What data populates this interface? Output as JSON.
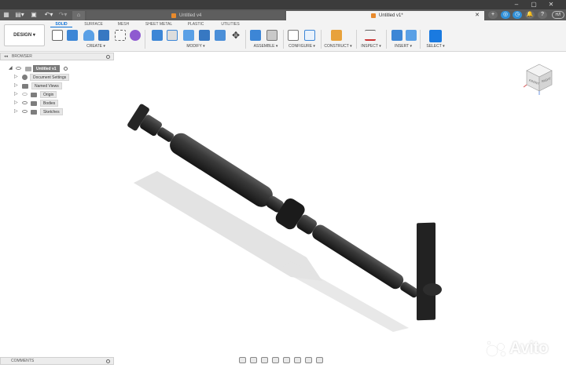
{
  "tabs": {
    "inactive": {
      "label": "Untitled v4"
    },
    "active": {
      "label": "Untitled v1*"
    }
  },
  "user": {
    "initials": "HЛ"
  },
  "ribbon": {
    "design_label": "DESIGN ▾",
    "tabs": [
      "SOLID",
      "SURFACE",
      "MESH",
      "SHEET METAL",
      "PLASTIC",
      "UTILITIES"
    ],
    "active_tab": "SOLID",
    "groups": [
      "CREATE ▾",
      "MODIFY ▾",
      "ASSEMBLE ▾",
      "CONFIGURE ▾",
      "CONSTRUCT ▾",
      "INSPECT ▾",
      "INSERT ▾",
      "SELECT ▾"
    ]
  },
  "browser": {
    "title": "BROWSER",
    "root": "Untitled v1",
    "items": [
      "Document Settings",
      "Named Views",
      "Origin",
      "Bodies",
      "Sketches"
    ]
  },
  "comments": {
    "title": "COMMENTS"
  },
  "viewcube": {
    "faces": [
      "FRONT",
      "RIGHT"
    ]
  },
  "watermark": {
    "text": "Avito"
  },
  "colors": {
    "accent": "#0a6fd6",
    "doc_icon": "#e88a2c",
    "model": "#2b2b2b"
  }
}
